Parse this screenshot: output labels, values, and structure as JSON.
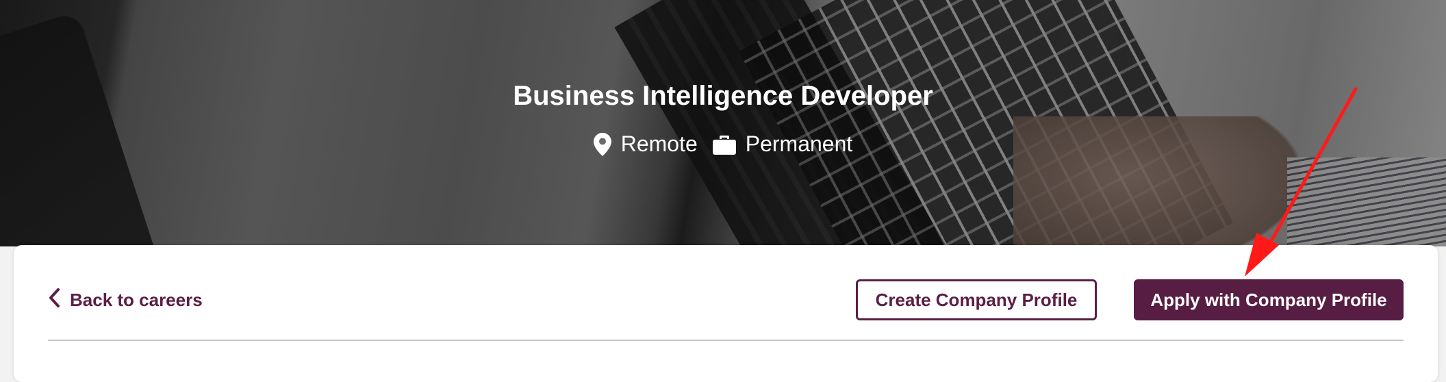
{
  "job": {
    "title": "Business Intelligence Developer",
    "location": "Remote",
    "employment_type": "Permanent"
  },
  "nav": {
    "back_label": "Back to careers"
  },
  "actions": {
    "create_profile_label": "Create Company Profile",
    "apply_label": "Apply with Company Profile"
  },
  "colors": {
    "brand": "#571d43",
    "annotation_arrow": "#ff1a1a"
  },
  "icons": {
    "location": "map-pin-icon",
    "employment": "briefcase-icon",
    "back": "chevron-left-icon"
  }
}
